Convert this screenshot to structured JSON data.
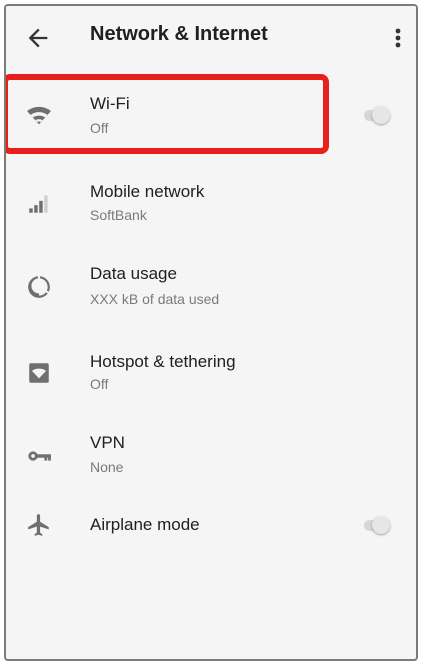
{
  "appbar": {
    "title": "Network & Internet",
    "back_icon": "arrow-back-icon",
    "menu_icon": "more-vert-icon"
  },
  "items": [
    {
      "label": "Wi-Fi",
      "subtitle": "Off",
      "icon": "wifi-icon",
      "toggle": "off"
    },
    {
      "label": "Mobile network",
      "subtitle": "SoftBank",
      "icon": "signal-cellular-icon"
    },
    {
      "label": "Data usage",
      "subtitle": "XXX kB of data used",
      "icon": "data-usage-icon"
    },
    {
      "label": "Hotspot & tethering",
      "subtitle": "Off",
      "icon": "hotspot-icon"
    },
    {
      "label": "VPN",
      "subtitle": "None",
      "icon": "vpn-key-icon"
    },
    {
      "label": "Airplane mode",
      "icon": "airplane-icon",
      "toggle": "off"
    }
  ],
  "colors": {
    "highlight": "#e8201c",
    "background": "#f5f5f5",
    "text_primary": "#202020",
    "text_secondary": "#7a7a7a",
    "icon": "#6f6f6f"
  }
}
